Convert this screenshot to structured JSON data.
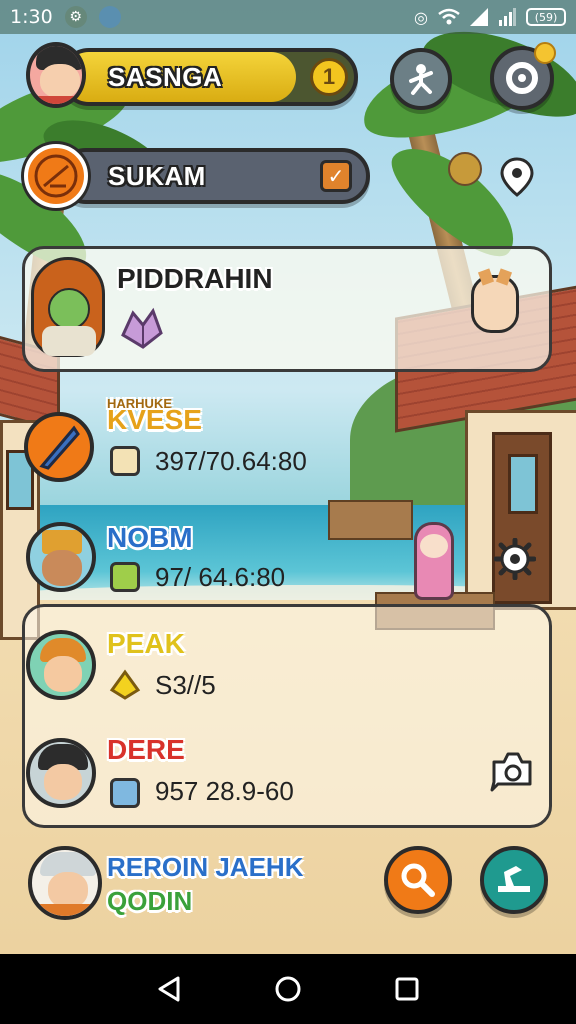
{
  "status_bar": {
    "time": "1:30",
    "battery": "(59)"
  },
  "player": {
    "name": "SASNGA",
    "level_badge": "1"
  },
  "quest": {
    "name": "SUKAM"
  },
  "card": {
    "title": "PIDDRAHIN"
  },
  "stats": [
    {
      "title": "KVESE",
      "subtitle": "HARHUKE",
      "value": "397/70.64:80",
      "title_color": "#e6a21a"
    },
    {
      "title": "NOBM",
      "value": "97/ 64.6:80",
      "title_color": "#2a6fc9"
    },
    {
      "title": "PEAK",
      "value": "S3//5",
      "title_color": "#e0c21c"
    },
    {
      "title": "DERE",
      "value": "957 28.9-60",
      "title_color": "#d8322b"
    }
  ],
  "footer": {
    "name": "REROIN JAEHK",
    "sub": "QODIN"
  },
  "colors": {
    "xp_bar": "#7d8a2e",
    "coin": "#f3c51f",
    "quest_bar": "#5a6270",
    "search_btn": "#f07a17",
    "action_btn": "#1f9a8f"
  },
  "icons": [
    "run-icon",
    "settings-gear-icon",
    "location-pin-icon",
    "feather-icon",
    "crystal-icon",
    "gear-icon",
    "camera-icon",
    "search-icon",
    "build-icon"
  ]
}
